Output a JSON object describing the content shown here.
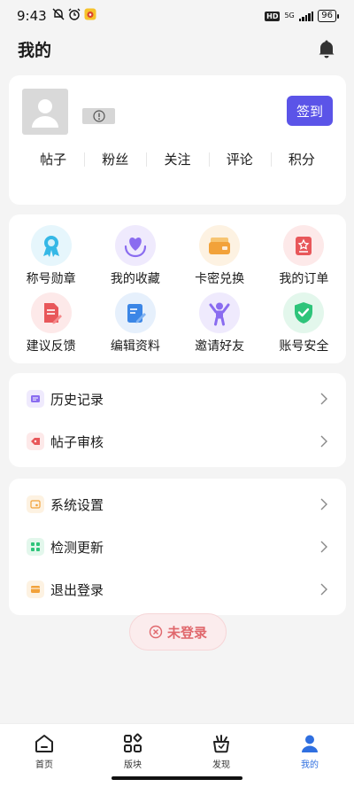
{
  "status_bar": {
    "time": "9:43",
    "network": "5G",
    "hd": "HD",
    "battery": "96"
  },
  "header": {
    "title": "我的"
  },
  "profile": {
    "signin_label": "签到",
    "stats": [
      "帖子",
      "粉丝",
      "关注",
      "评论",
      "积分"
    ]
  },
  "grid": [
    {
      "label": "称号勋章",
      "icon": "medal-icon",
      "color": "#35b8e6",
      "bg": "#e6f6fc"
    },
    {
      "label": "我的收藏",
      "icon": "heart-hands-icon",
      "color": "#8a6cf0",
      "bg": "#efeafd"
    },
    {
      "label": "卡密兑换",
      "icon": "card-wallet-icon",
      "color": "#f2a23a",
      "bg": "#fdf2e2"
    },
    {
      "label": "我的订单",
      "icon": "order-icon",
      "color": "#e8575a",
      "bg": "#fde9e9"
    },
    {
      "label": "建议反馈",
      "icon": "feedback-doc-icon",
      "color": "#e8575a",
      "bg": "#fde9e9"
    },
    {
      "label": "编辑资料",
      "icon": "edit-doc-icon",
      "color": "#3b86e6",
      "bg": "#e6f0fc"
    },
    {
      "label": "邀请好友",
      "icon": "invite-person-icon",
      "color": "#8a6cf0",
      "bg": "#efeafd"
    },
    {
      "label": "账号安全",
      "icon": "shield-check-icon",
      "color": "#2ec47a",
      "bg": "#e3f7ec"
    }
  ],
  "list1": [
    {
      "label": "历史记录",
      "icon": "history-icon",
      "color": "#8a6cf0",
      "bg": "#efeafd"
    },
    {
      "label": "帖子审核",
      "icon": "review-tag-icon",
      "color": "#e8575a",
      "bg": "#fde9e9"
    }
  ],
  "list2": [
    {
      "label": "系统设置",
      "icon": "settings-icon",
      "color": "#f2a23a",
      "bg": "#fdf2e2"
    },
    {
      "label": "检测更新",
      "icon": "update-grid-icon",
      "color": "#2ec47a",
      "bg": "#e3f7ec"
    },
    {
      "label": "退出登录",
      "icon": "logout-icon",
      "color": "#f2a23a",
      "bg": "#fdf2e2"
    }
  ],
  "login_status": "未登录",
  "nav": [
    {
      "label": "首页",
      "icon": "home-icon"
    },
    {
      "label": "版块",
      "icon": "category-icon"
    },
    {
      "label": "发现",
      "icon": "discover-icon"
    },
    {
      "label": "我的",
      "icon": "profile-icon",
      "active": true
    }
  ],
  "colors": {
    "accent": "#5b54e8",
    "nav_active": "#2f6fe0",
    "login_warn": "#e0676c"
  }
}
